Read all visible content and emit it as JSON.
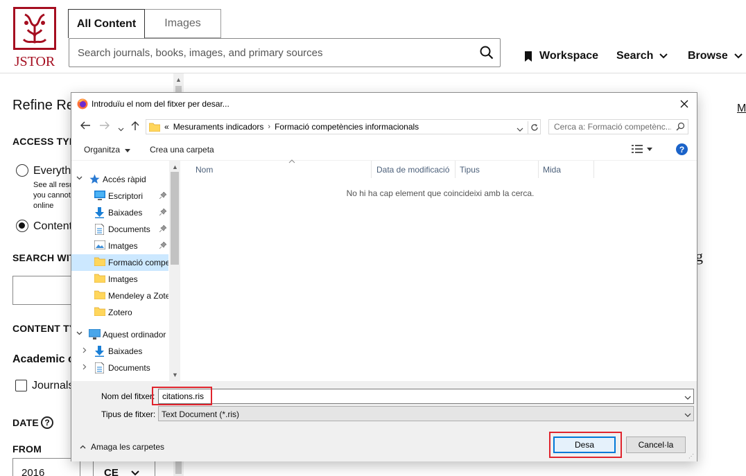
{
  "site": {
    "logo_text": "JSTOR",
    "tabs": [
      {
        "label": "All Content"
      },
      {
        "label": "Images"
      }
    ],
    "search_placeholder": "Search journals, books, images, and primary sources",
    "nav": {
      "workspace": "Workspace",
      "search": "Search",
      "browse": "Browse"
    },
    "brand_color": "#a50e20"
  },
  "sidebar": {
    "refine": "Refine Re",
    "access_type": "ACCESS TYPE",
    "everything": "Everyth",
    "everything_note": "See all resu you cannot online",
    "content": "Content",
    "search_within": "SEARCH WIT",
    "content_type": "CONTENT TY",
    "academic": "Academic c",
    "journals": "Journals",
    "date": "DATE",
    "date_help": "?",
    "from": "FROM",
    "from_value": "2016",
    "era_value": "CE"
  },
  "right_fragments": {
    "m": "M",
    "g": "g"
  },
  "dialog": {
    "title": "Introduïu el nom del fitxer per desar...",
    "breadcrumb": [
      "Mesuraments indicadors",
      "Formació competències informacionals"
    ],
    "breadcrumb_prefix": "«",
    "search_placeholder": "Cerca a: Formació competènc...",
    "toolbar": {
      "organize": "Organitza",
      "new_folder": "Crea una carpeta",
      "help": "?"
    },
    "nav_items": [
      {
        "label": "Accés ràpid",
        "icon": "star-icon"
      },
      {
        "label": "Escriptori",
        "icon": "desktop-icon"
      },
      {
        "label": "Baixades",
        "icon": "download-icon"
      },
      {
        "label": "Documents",
        "icon": "document-icon"
      },
      {
        "label": "Imatges",
        "icon": "image-icon"
      },
      {
        "label": "Formació compe",
        "icon": "folder-icon"
      },
      {
        "label": "Imatges",
        "icon": "folder-icon"
      },
      {
        "label": "Mendeley a Zote",
        "icon": "folder-icon"
      },
      {
        "label": "Zotero",
        "icon": "folder-icon"
      },
      {
        "label": "Aquest ordinador",
        "icon": "computer-icon"
      },
      {
        "label": "Baixades",
        "icon": "download-icon"
      },
      {
        "label": "Documents",
        "icon": "document-icon"
      }
    ],
    "columns": {
      "name": "Nom",
      "modified": "Data de modificació",
      "type": "Tipus",
      "size": "Mida"
    },
    "empty_message": "No hi ha cap element que coincideixi amb la cerca.",
    "filename_label": "Nom del fitxer:",
    "filename_value": "citations.ris",
    "filetype_label": "Tipus de fitxer:",
    "filetype_value": "Text Document (*.ris)",
    "hide_folders": "Amaga les carpetes",
    "save": "Desa",
    "cancel": "Cancel·la",
    "accent_color": "#0078d7",
    "highlight_color": "#e0242d"
  }
}
